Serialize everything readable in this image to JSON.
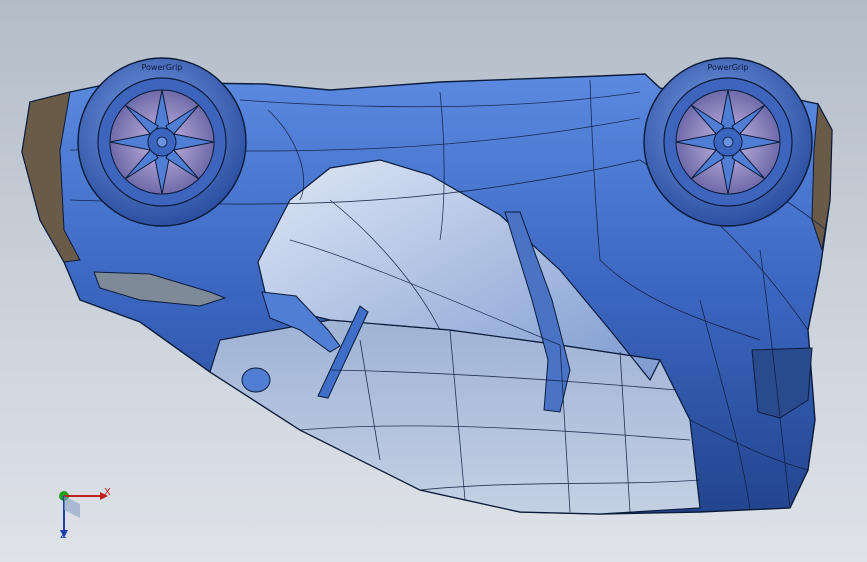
{
  "viewport": {
    "background_top": "#b3bdc8",
    "background_bottom": "#dfe3e8",
    "model": {
      "subject": "car-body-upside-down-3d-model",
      "body_color": "#3f6fc9",
      "glass_color": "#b4c4dc",
      "edge_color": "#0b1b3a",
      "tire_text_left": "PowerGrip",
      "tire_text_right": "PowerGrip"
    },
    "triad": {
      "x_label": "X",
      "z_label": "Z",
      "x_color": "#c02020",
      "y_color": "#20a020",
      "z_color": "#1f3fb0"
    }
  }
}
